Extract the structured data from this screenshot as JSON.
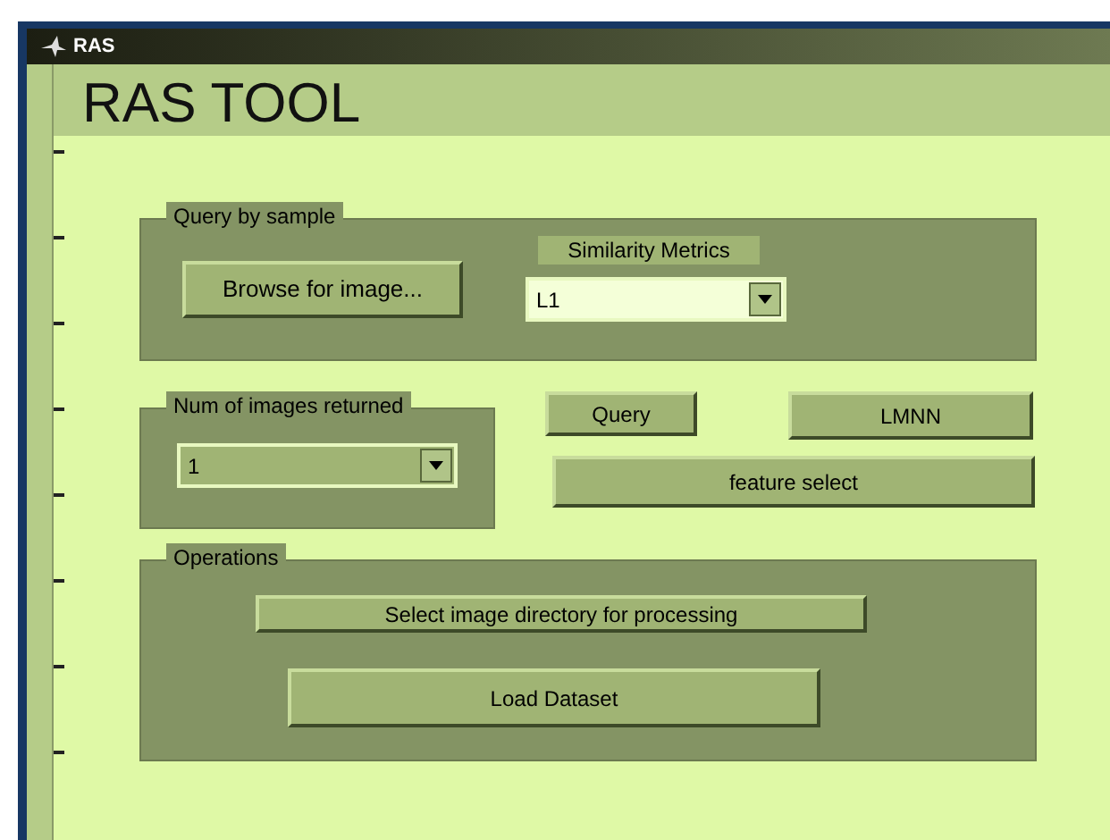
{
  "window": {
    "title": "RAS"
  },
  "header": "RAS TOOL",
  "query_by_sample": {
    "label": "Query by sample",
    "browse_button": "Browse for image...",
    "metric_label": "Similarity Metrics",
    "metric_select": {
      "value": "L1"
    }
  },
  "num_images": {
    "label": "Num of images returned",
    "select": {
      "value": "1"
    }
  },
  "buttons": {
    "query": "Query",
    "lmnn": "LMNN",
    "feature_select": "feature select"
  },
  "operations": {
    "label": "Operations",
    "buttons": [
      "Select image directory for processing",
      "Load Dataset"
    ]
  }
}
